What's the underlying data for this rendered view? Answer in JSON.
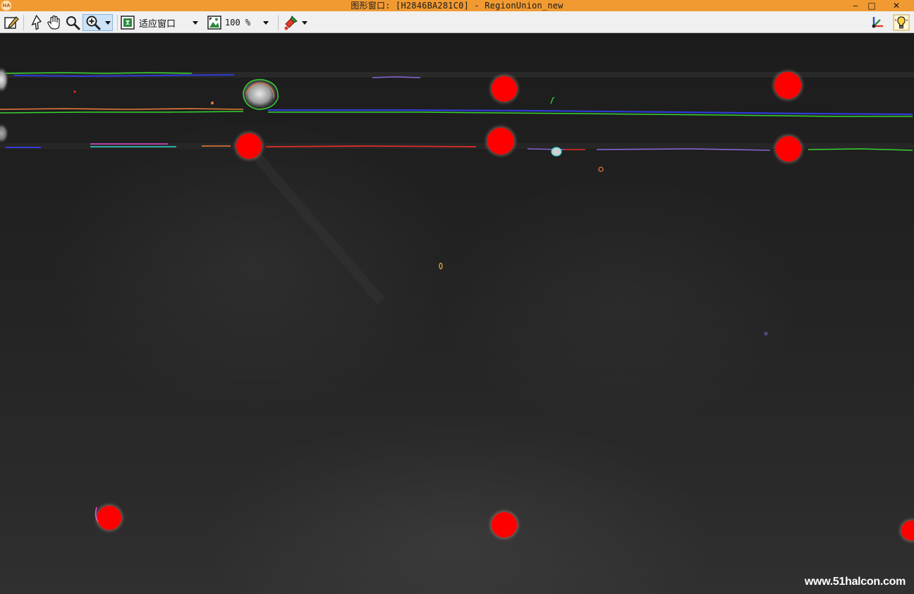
{
  "window": {
    "title": "图形窗口: [H2846BA281C0] - RegionUnion_new",
    "controls": [
      "minimize",
      "maximize",
      "close"
    ],
    "control_glyphs": {
      "minimize": "‒",
      "maximize": "□",
      "close": "✕"
    },
    "app_icon_text": "HA"
  },
  "toolbar": {
    "zoom_fit_label": "适应窗口",
    "zoom_percent": "100 %",
    "active_tool": "zoom-in",
    "icons": [
      "edit-icon",
      "pointer-icon",
      "pan-hand-icon",
      "magnifier-icon",
      "zoom-in-icon",
      "fit-window-icon",
      "zoom-percent-icon",
      "paint-tool-icon",
      "coordinate-axes-icon",
      "lightbulb-icon"
    ]
  },
  "canvas": {
    "marker_color": "#ff0000",
    "background_color": "#1e1e1e",
    "watermark": "www.51halcon.com"
  },
  "colors": {
    "title_bar": "#f19a32",
    "toolbar": "#f0f0f0"
  }
}
